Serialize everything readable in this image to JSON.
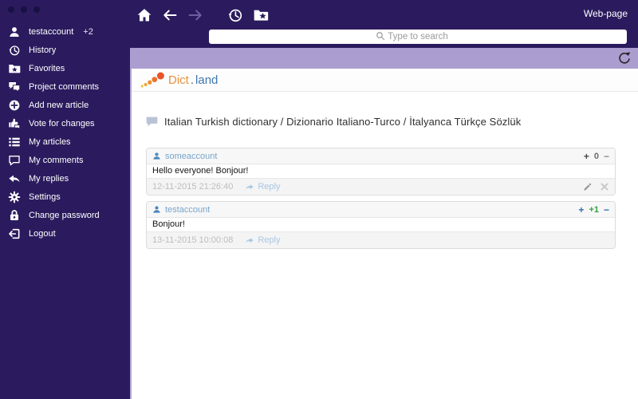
{
  "window": {
    "webpage_label": "Web-page"
  },
  "sidebar": {
    "account": {
      "label": "testaccount",
      "badge": "+2",
      "icon": "user-icon"
    },
    "items": [
      {
        "label": "History",
        "icon": "history-icon"
      },
      {
        "label": "Favorites",
        "icon": "favorites-folder-icon"
      },
      {
        "label": "Project comments",
        "icon": "project-comments-icon"
      },
      {
        "label": "Add new article",
        "icon": "add-article-icon"
      },
      {
        "label": "Vote for changes",
        "icon": "vote-changes-icon"
      },
      {
        "label": "My articles",
        "icon": "my-articles-icon"
      },
      {
        "label": "My comments",
        "icon": "my-comments-icon"
      },
      {
        "label": "My replies",
        "icon": "my-replies-icon"
      },
      {
        "label": "Settings",
        "icon": "settings-gear-icon"
      },
      {
        "label": "Change password",
        "icon": "lock-icon"
      },
      {
        "label": "Logout",
        "icon": "logout-icon"
      }
    ]
  },
  "navbar": {
    "search_placeholder": "Type to search",
    "icons": [
      "home-icon",
      "back-arrow-icon",
      "forward-arrow-icon",
      "history-icon",
      "bookmarks-folder-icon",
      "search-icon"
    ]
  },
  "toolbar": {
    "icon": "refresh-icon"
  },
  "site": {
    "logo_dict": "Dict",
    "logo_dot": ".",
    "logo_land": "land"
  },
  "page": {
    "title": "Italian Turkish dictionary / Dizionario Italiano-Turco / İtalyanca Türkçe Sözlük"
  },
  "comments": [
    {
      "author": "someaccount",
      "text": "Hello everyone! Bonjour!",
      "timestamp": "12-11-2015 21:26:40",
      "reply_label": "Reply",
      "vote_up": "+",
      "score": "0",
      "vote_down": "−"
    },
    {
      "author": "testaccount",
      "text": "Bonjour!",
      "timestamp": "13-11-2015 10:00:08",
      "reply_label": "Reply",
      "vote_up": "+",
      "score": "+1",
      "vote_down": "−"
    }
  ],
  "colors": {
    "sidebar_bg": "#2b1b5e",
    "topbar_bg": "#2b1b5e",
    "toolbar_bg": "#ab9dcf",
    "logo_orange": "#e8913c",
    "logo_blue": "#4178ae",
    "username_blue": "#79a5c9",
    "vote_blue": "#2f6fb3",
    "score_green": "#33a03c",
    "timestamp_gray": "#bdbdbd",
    "reply_blue": "#a9c6e2"
  }
}
